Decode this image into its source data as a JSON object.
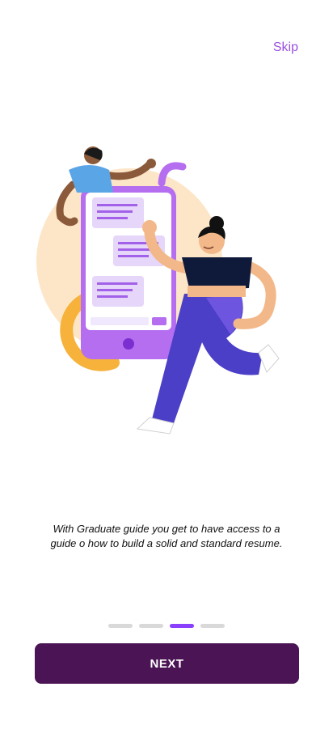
{
  "header": {
    "skip_label": "Skip"
  },
  "onboarding": {
    "illustration_icon": "people-chatting-with-phone-illustration",
    "caption_line1": "With Graduate guide you get to have access to a",
    "caption_line2": "guide o how to build a solid and standard resume.",
    "total_pages": 4,
    "current_page": 3
  },
  "footer": {
    "next_label": "NEXT"
  },
  "colors": {
    "accent": "#9b51e0",
    "indicator_active": "#8a3ffc",
    "indicator_inactive": "#d9d9d9",
    "button_bg": "#4b1454",
    "button_text": "#ffffff"
  }
}
